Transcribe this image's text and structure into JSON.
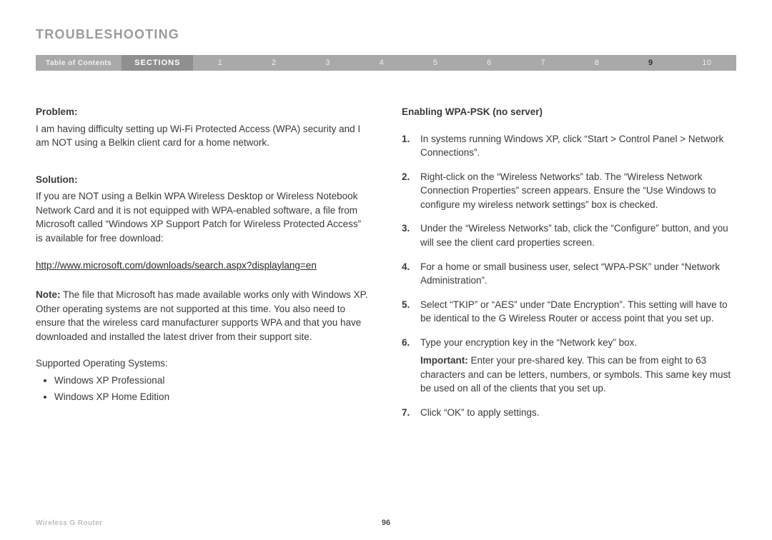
{
  "title": "TROUBLESHOOTING",
  "nav": {
    "toc": "Table of Contents",
    "sections_label": "SECTIONS",
    "items": [
      "1",
      "2",
      "3",
      "4",
      "5",
      "6",
      "7",
      "8",
      "9",
      "10"
    ],
    "active_index": 8
  },
  "left": {
    "problem_label": "Problem:",
    "problem_text": "I am having difficulty setting up Wi-Fi Protected Access (WPA) security and I am NOT using a Belkin client card for a home network.",
    "solution_label": "Solution:",
    "solution_text": "If you are NOT using a Belkin WPA Wireless Desktop or Wireless Notebook Network Card and it is not equipped with WPA-enabled software, a file from Microsoft called “Windows XP Support Patch for Wireless Protected Access” is available for free download:",
    "link": "http://www.microsoft.com/downloads/search.aspx?displaylang=en",
    "note_label": "Note:",
    "note_text": " The file that Microsoft has made available works only with Windows XP. Other operating systems are not supported at this time. You also need to ensure that the wireless card manufacturer supports WPA and that you have downloaded and installed the latest driver from their support site.",
    "supported_heading": "Supported Operating Systems:",
    "supported_items": [
      "Windows XP Professional",
      "Windows XP Home Edition"
    ]
  },
  "right": {
    "heading": "Enabling WPA-PSK (no server)",
    "steps": [
      "In systems running Windows XP, click “Start > Control Panel > Network Connections”.",
      "Right-click on the “Wireless Networks” tab. The “Wireless Network Connection Properties” screen appears. Ensure the “Use Windows to configure my wireless network settings” box is checked.",
      "Under the “Wireless Networks” tab, click the “Configure” button, and you will see the client card properties screen.",
      "For a home or small business user, select “WPA-PSK” under “Network Administration”.",
      "Select “TKIP” or “AES” under “Date Encryption”. This setting will have to be identical to the G Wireless Router or access point that you set up.",
      "Type your encryption key in the “Network key” box."
    ],
    "important_label": "Important:",
    "important_text": " Enter your pre-shared key. This can be from eight to 63 characters and can be letters, numbers, or symbols. This same key must be used on all of the clients that you set up.",
    "step7": "Click “OK” to apply settings."
  },
  "footer": {
    "product": "Wireless G Router",
    "page": "96"
  }
}
